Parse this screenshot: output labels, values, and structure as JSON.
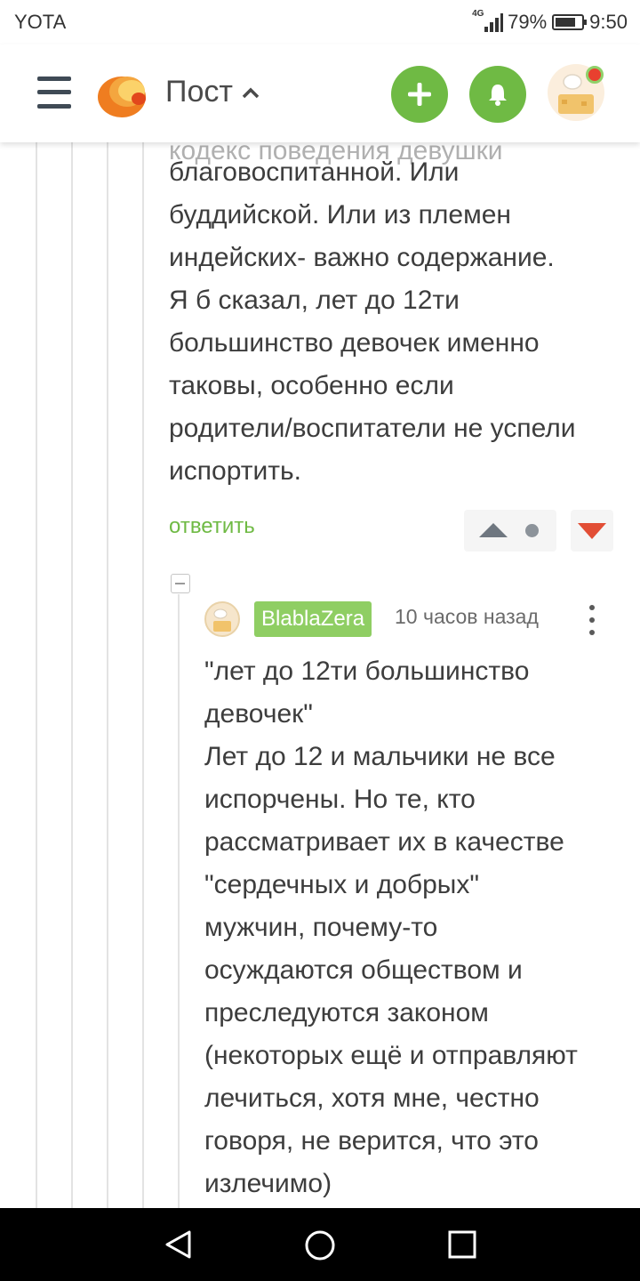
{
  "status_bar": {
    "carrier": "YOTA",
    "network": "4G",
    "battery_text": "79%",
    "battery_level": 0.79,
    "time": "9:50"
  },
  "header": {
    "title": "Пост",
    "menu_icon": "hamburger-icon",
    "add_icon": "plus-icon",
    "bell_icon": "bell-icon",
    "accent_color": "#6fba44"
  },
  "parent_comment": {
    "lines": [
      "благовоспитанной. Или",
      "буддийской. Или из племен",
      "индейских- важно содержание.",
      "Я б сказал, лет до 12ти",
      "большинство девочек именно",
      "таковы, особенно если",
      "родители/воспитатели не успели",
      "испортить."
    ],
    "reply_label": "ответить"
  },
  "reply_comment": {
    "author": "BlablaZera",
    "time": "10 часов назад",
    "lines": [
      "\"лет до 12ти большинство",
      "девочек\"",
      "Лет до 12 и мальчики не все",
      "испорчены. Но те, кто",
      "рассматривает их в качестве",
      "\"сердечных и добрых\"",
      "мужчин, почему-то",
      "осуждаются обществом и",
      "преследуются законом",
      "(некоторых ещё и отправляют",
      "лечиться, хотя мне, честно",
      "говоря, не верится, что это",
      "излечимо)"
    ]
  }
}
